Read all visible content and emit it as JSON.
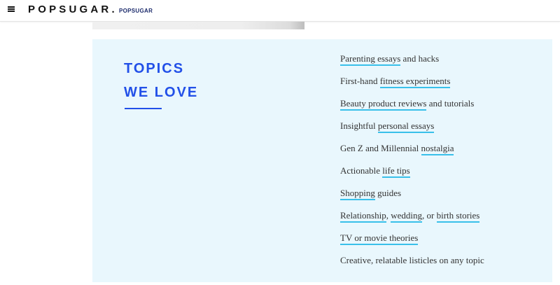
{
  "header": {
    "logo": "POPSUGAR",
    "logo_dot": ".",
    "logo_sub": "POPSUGAR"
  },
  "colors": {
    "title_blue": "#2250e8",
    "link_underline": "#39c0ea",
    "panel_bg": "#e9f7fd"
  },
  "topics": {
    "title_line1": "TOPICS",
    "title_line2": "WE LOVE",
    "items": [
      {
        "a": "Parenting essays",
        "b": " and hacks"
      },
      {
        "a": "First-hand ",
        "b": "fitness experiments"
      },
      {
        "a": "Beauty product reviews",
        "b": " and tutorials"
      },
      {
        "a": "Insightful ",
        "b": "personal essays"
      },
      {
        "a": "Gen Z and Millennial ",
        "b": "nostalgia"
      },
      {
        "a": "Actionable ",
        "b": "life tips"
      },
      {
        "a": "Shopping",
        "b": " guides"
      },
      {
        "a": "Relationship",
        "b": ", ",
        "c": "wedding",
        "d": ", or ",
        "e": "birth stories"
      },
      {
        "a": "TV or movie theories"
      },
      {
        "a": "Creative, relatable listicles on any topic"
      }
    ]
  }
}
